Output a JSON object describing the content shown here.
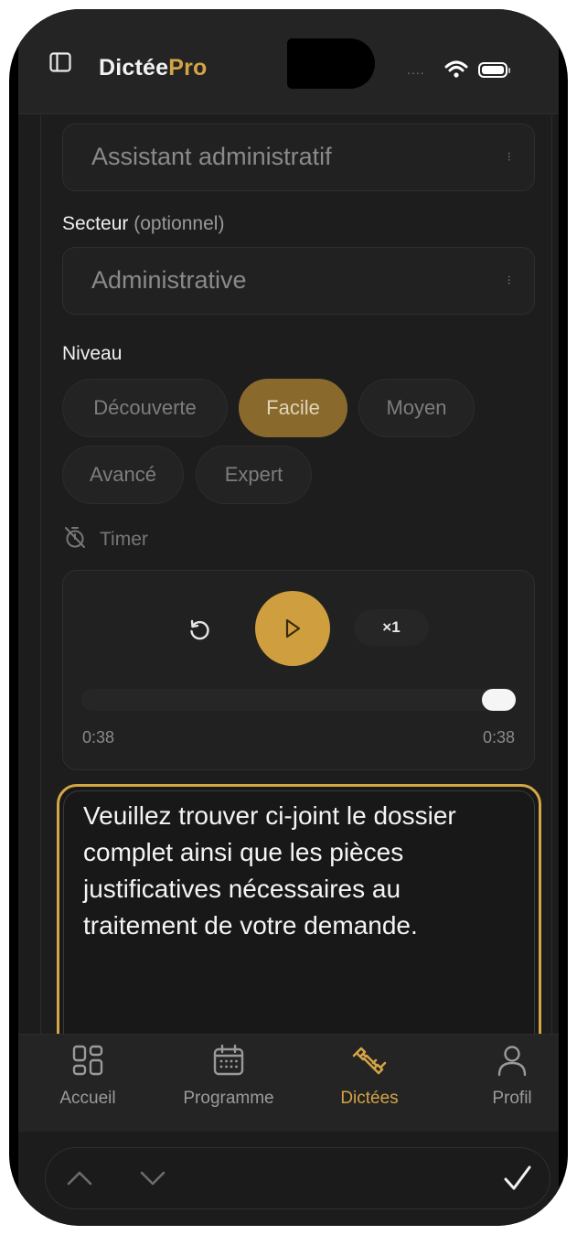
{
  "app": {
    "logo_part1": "Dictée",
    "logo_part2": "Pro"
  },
  "status": {
    "signal_dots": "....",
    "accent": "#d3a445"
  },
  "form": {
    "poste_value": "Assistant administratif",
    "secteur_label": "Secteur",
    "secteur_optional": "(optionnel)",
    "secteur_value": "Administrative",
    "niveau_label": "Niveau",
    "levels": [
      "Découverte",
      "Facile",
      "Moyen",
      "Avancé",
      "Expert"
    ],
    "selected_level": "Facile",
    "timer_label": "Timer"
  },
  "player": {
    "speed_label": "×1",
    "current_time": "0:38",
    "total_time": "0:38",
    "progress": 1.0
  },
  "dictation": {
    "text": "Veuillez trouver ci-joint le dossier complet ainsi que les pièces justificatives nécessaires au traitement de votre demande."
  },
  "tabs": [
    {
      "label": "Accueil",
      "icon": "grid-icon"
    },
    {
      "label": "Programme",
      "icon": "calendar-icon"
    },
    {
      "label": "Dictées",
      "icon": "dumbbell-icon",
      "active": true
    },
    {
      "label": "Profil",
      "icon": "user-icon"
    }
  ],
  "keyboard_bar": {
    "done_icon": "checkmark-icon"
  }
}
